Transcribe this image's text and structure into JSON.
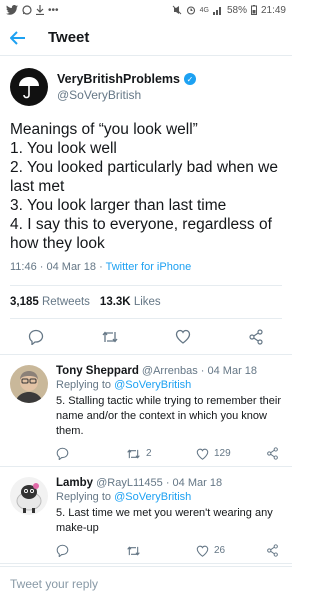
{
  "status_bar": {
    "left_icons": [
      "twitter-icon",
      "whatsapp-icon",
      "download-icon",
      "more-icon"
    ],
    "battery": "58%",
    "time": "21:49",
    "network": "4G"
  },
  "header": {
    "title": "Tweet"
  },
  "tweet": {
    "author_name": "VeryBritishProblems",
    "author_handle": "@SoVeryBritish",
    "text": "Meanings of “you look well”\n1. You look well\n2. You looked particularly bad when we last met\n3. You look larger than last time\n4. I say this to everyone, regardless of how they look",
    "timestamp": "11:46 · 04 Mar 18 · ",
    "source": "Twitter for iPhone",
    "retweets_count": "3,185",
    "retweets_label": "Retweets",
    "likes_count": "13.3K",
    "likes_label": "Likes"
  },
  "replies": [
    {
      "name": "Tony Sheppard",
      "handle": "@Arrenbas",
      "date": "· 04 Mar 18",
      "replying_prefix": "Replying to ",
      "replying_to": "@SoVeryBritish",
      "text": "5. Stalling tactic while trying to remember their name and/or the context in which you know them.",
      "retweets": "2",
      "likes": "129"
    },
    {
      "name": "Lamby",
      "handle": "@RayL11455",
      "date": "· 04 Mar 18",
      "replying_prefix": "Replying to ",
      "replying_to": "@SoVeryBritish",
      "text": "5. Last time we met you weren't wearing any make-up",
      "retweets": "",
      "likes": "26"
    }
  ],
  "compose": {
    "placeholder": "Tweet your reply"
  },
  "colors": {
    "accent": "#1da1f2",
    "muted": "#657786",
    "text": "#14171a"
  }
}
